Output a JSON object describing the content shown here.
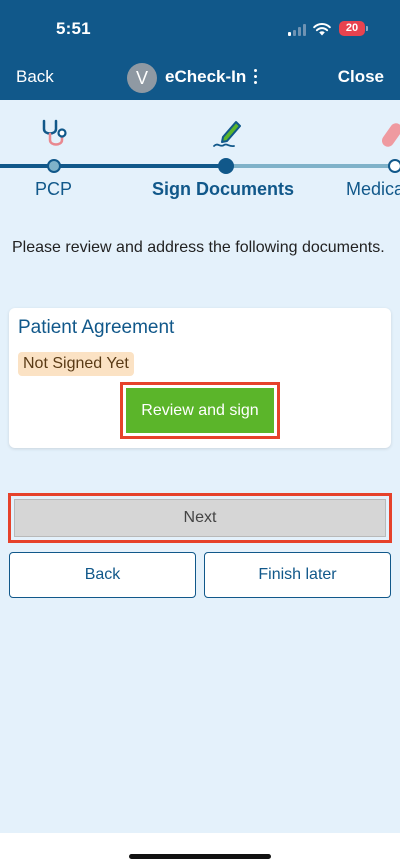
{
  "status_bar": {
    "time": "5:51",
    "battery": "20"
  },
  "header": {
    "back_label": "Back",
    "avatar_initial": "V",
    "title": "eCheck-In",
    "close_label": "Close"
  },
  "stepper": {
    "steps": [
      {
        "label": "PCP",
        "state": "completed",
        "icon": "stethoscope-icon"
      },
      {
        "label": "Sign Documents",
        "state": "current",
        "icon": "pen-signature-icon"
      },
      {
        "label": "Medica",
        "state": "upcoming",
        "icon": "pill-icon"
      }
    ]
  },
  "intro_text": "Please review and address the following documents.",
  "document": {
    "title": "Patient Agreement",
    "status": "Not Signed Yet",
    "action_label": "Review and sign"
  },
  "actions": {
    "next_label": "Next",
    "back_label": "Back",
    "finish_later_label": "Finish later"
  },
  "colors": {
    "brand": "#11588a",
    "accent_green": "#5bb52a",
    "highlight": "#e6422b",
    "badge_bg": "#fbe2c4",
    "background": "#e4f1fb"
  }
}
